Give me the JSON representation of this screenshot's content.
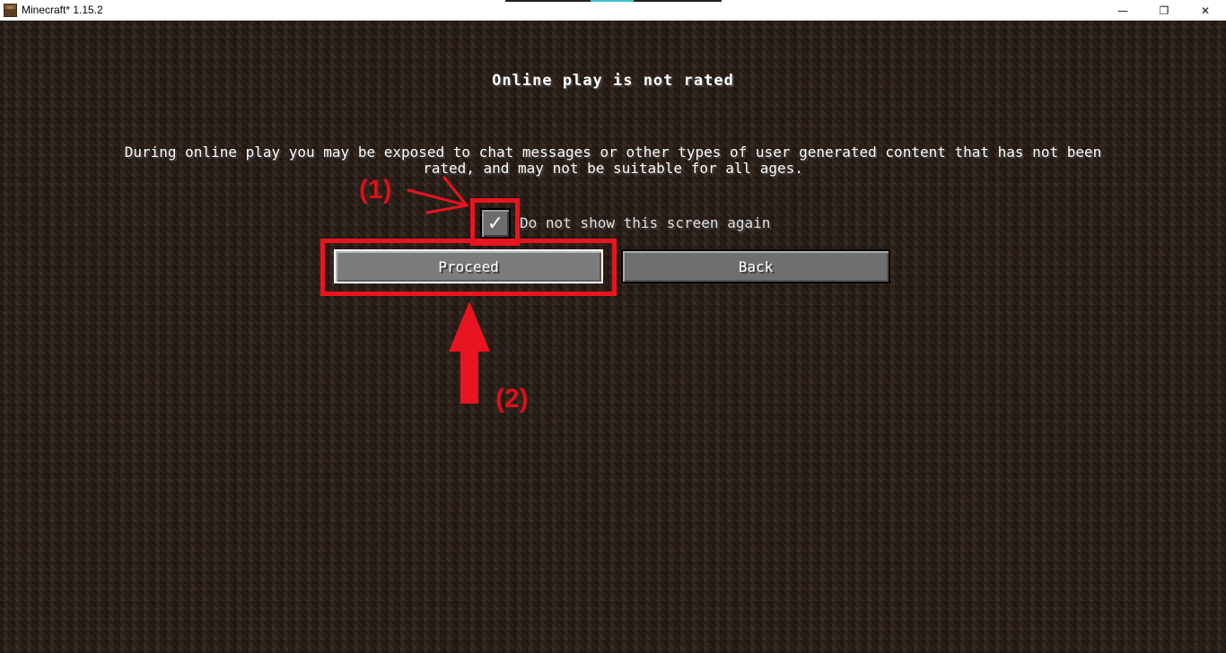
{
  "window": {
    "title": "Minecraft* 1.15.2",
    "minimize_glyph": "—",
    "restore_glyph": "❐",
    "close_glyph": "✕"
  },
  "screen": {
    "title": "Online play is not rated",
    "warning_line1": "During online play you may be exposed to chat messages or other types of user generated content that has not been",
    "warning_line2": "rated, and may not be suitable for all ages.",
    "checkbox": {
      "checked": true,
      "check_glyph": "✓",
      "label": "Do not show this screen again"
    },
    "buttons": {
      "proceed": "Proceed",
      "back": "Back"
    }
  },
  "annotations": {
    "step1": "(1)",
    "step2": "(2)",
    "color": "#e8141f"
  },
  "icons": {
    "app": "minecraft-block-icon",
    "minimize": "minimize-icon",
    "restore": "restore-icon",
    "close": "close-icon"
  }
}
